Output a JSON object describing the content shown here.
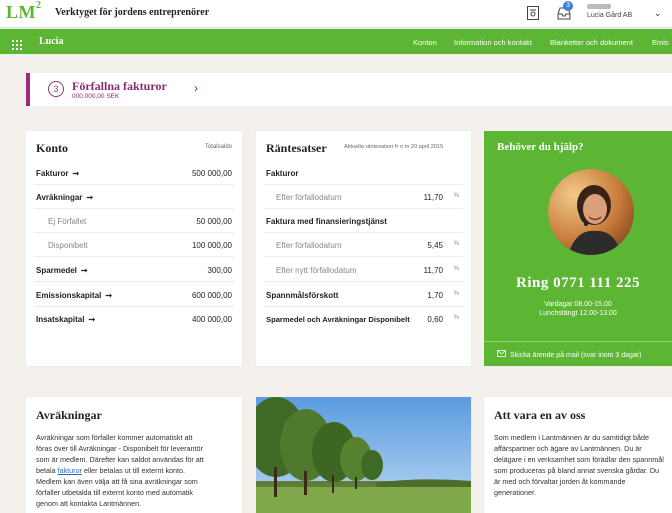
{
  "header": {
    "logo": "LM",
    "logo_sup": "2",
    "tagline": "Verktyget för jordens entreprenörer",
    "badge_count": "3",
    "company": "Lucia Gård AB"
  },
  "nav": {
    "user": "Lucia",
    "items": [
      "Konton",
      "Information och kontakt",
      "Blanketter och dokument",
      "Emis"
    ]
  },
  "overdue": {
    "count": "3",
    "title": "Förfallna fakturor",
    "amount": "000.000,00 SEK"
  },
  "konto": {
    "title": "Konto",
    "column": "Totalsaldo",
    "rows": [
      {
        "label": "Fakturor",
        "value": "500 000,00"
      },
      {
        "label": "Avräkningar",
        "value": ""
      },
      {
        "label": "Ej Förfallet",
        "value": "50 000,00"
      },
      {
        "label": "Disponibelt",
        "value": "100 000,00"
      },
      {
        "label": "Sparmedel",
        "value": "300,00"
      },
      {
        "label": "Emissionskapital",
        "value": "600 000,00"
      },
      {
        "label": "Insatskapital",
        "value": "400 000,00"
      }
    ]
  },
  "rantesatser": {
    "title": "Räntesatser",
    "subtitle": "Aktuella räntesatser fr o m 20 april 2015",
    "unit": "%",
    "rows": [
      {
        "label": "Fakturor",
        "value": ""
      },
      {
        "label": "Efter förfallodatum",
        "value": "11,70"
      },
      {
        "label": "Faktura med finansieringstjänst",
        "value": ""
      },
      {
        "label": "Efter förfallodatum",
        "value": "5,45"
      },
      {
        "label": "Efter nytt förfallodatum",
        "value": "11,70"
      },
      {
        "label": "Spannmålsförskott",
        "value": "1,70"
      },
      {
        "label": "Sparmedel och Avräkningar Disponibelt",
        "value": "0,60"
      }
    ]
  },
  "help": {
    "title": "Behöver du hjälp?",
    "phone": "Ring 0771 111 225",
    "hours1": "Vardagar 08.00-15.00",
    "hours2": "Lunchstängt 12.00-13.00",
    "message": "Skicka ärende på mail (svar inom 3 dagar)"
  },
  "avrakningar": {
    "title": "Avräkningar",
    "p1": "Avräkningar som förfaller kommer automatiskt att",
    "p2": "föras över till Avräkningar - Disponibelt för leverantör",
    "p3": "som är medlem. Därefter kan saldot användas för att",
    "p4a": "betala",
    "p4link": "fakturor",
    "p4b": "eller betalas ut till externt konto.",
    "p5": "Medlem kan även välja att få sina avräkningar som",
    "p6": "förfaller utbetalda till externt konto med automatik",
    "p7": "genom att kontakta Lantmännen."
  },
  "om_oss": {
    "title": "Att vara en av oss",
    "p1": "Som medlem i Lantmännen är du samtidigt både",
    "p2": "affärspartner och ägare av Lantmännen. Du är",
    "p3": "delägare i en verksamhet som förädlar den spannmål",
    "p4": "som produceras på bland annat svenska gårdar. Du",
    "p5": "är med och förvaltar jorden åt kommande",
    "p6": "generationer."
  }
}
